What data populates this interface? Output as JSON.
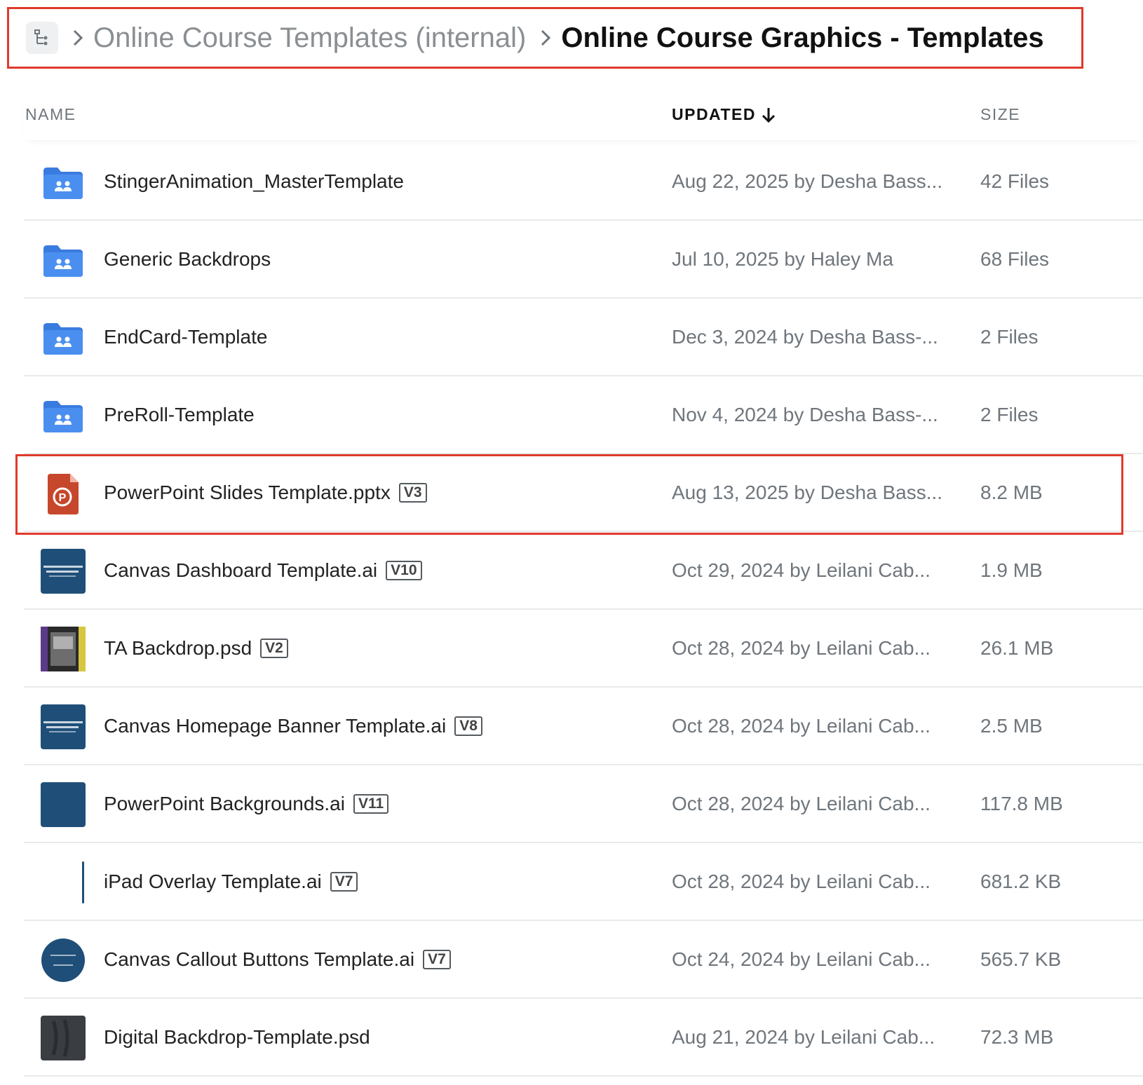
{
  "breadcrumb": {
    "parent": "Online Course Templates (internal)",
    "current": "Online Course Graphics - Templates"
  },
  "columns": {
    "name": "NAME",
    "updated": "UPDATED",
    "size": "SIZE"
  },
  "colors": {
    "highlight": "#e03a2b",
    "folder": "#4a8ff0",
    "pptx": "#c6472b",
    "ai_thumb": "#1f4f78"
  },
  "rows": [
    {
      "name": "StingerAnimation_MasterTemplate",
      "version": "",
      "updated": "Aug 22, 2025 by Desha Bass...",
      "size": "42 Files",
      "icon": "shared-folder-icon"
    },
    {
      "name": "Generic Backdrops",
      "version": "",
      "updated": "Jul 10, 2025 by Haley Ma",
      "size": "68 Files",
      "icon": "shared-folder-icon"
    },
    {
      "name": "EndCard-Template",
      "version": "",
      "updated": "Dec 3, 2024 by Desha Bass-...",
      "size": "2 Files",
      "icon": "shared-folder-icon"
    },
    {
      "name": "PreRoll-Template",
      "version": "",
      "updated": "Nov 4, 2024 by Desha Bass-...",
      "size": "2 Files",
      "icon": "shared-folder-icon"
    },
    {
      "name": "PowerPoint Slides Template.pptx",
      "version": "V3",
      "updated": "Aug 13, 2025 by Desha Bass...",
      "size": "8.2 MB",
      "icon": "powerpoint-file-icon"
    },
    {
      "name": "Canvas Dashboard Template.ai",
      "version": "V10",
      "updated": "Oct 29, 2024 by Leilani Cab...",
      "size": "1.9 MB",
      "icon": "ai-thumbnail"
    },
    {
      "name": "TA Backdrop.psd",
      "version": "V2",
      "updated": "Oct 28, 2024 by Leilani Cab...",
      "size": "26.1 MB",
      "icon": "psd-thumbnail"
    },
    {
      "name": "Canvas Homepage Banner Template.ai",
      "version": "V8",
      "updated": "Oct 28, 2024 by Leilani Cab...",
      "size": "2.5 MB",
      "icon": "ai-thumbnail"
    },
    {
      "name": "PowerPoint Backgrounds.ai",
      "version": "V11",
      "updated": "Oct 28, 2024 by Leilani Cab...",
      "size": "117.8 MB",
      "icon": "ai-thumbnail"
    },
    {
      "name": "iPad Overlay Template.ai",
      "version": "V7",
      "updated": "Oct 28, 2024 by Leilani Cab...",
      "size": "681.2 KB",
      "icon": "ai-thumbnail"
    },
    {
      "name": "Canvas Callout Buttons Template.ai",
      "version": "V7",
      "updated": "Oct 24, 2024 by Leilani Cab...",
      "size": "565.7 KB",
      "icon": "ai-thumbnail"
    },
    {
      "name": "Digital Backdrop-Template.psd",
      "version": "",
      "updated": "Aug 21, 2024 by Leilani Cab...",
      "size": "72.3 MB",
      "icon": "psd-thumbnail"
    }
  ]
}
